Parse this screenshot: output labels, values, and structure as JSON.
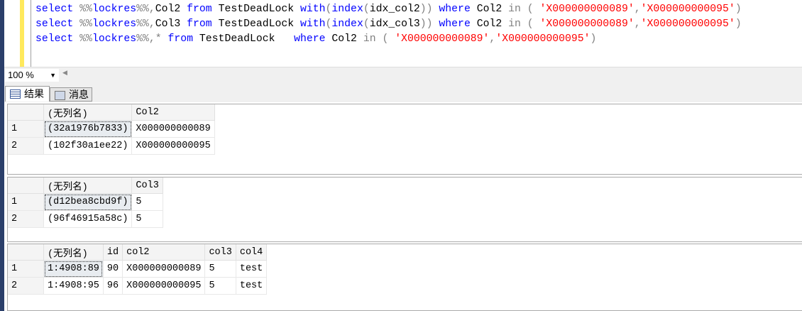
{
  "editor": {
    "lines": [
      [
        [
          "kw",
          "select "
        ],
        [
          "gr",
          "%%"
        ],
        [
          "kw",
          "lockres"
        ],
        [
          "gr",
          "%%,"
        ],
        [
          "tx",
          "Col2 "
        ],
        [
          "kw",
          "from "
        ],
        [
          "tx",
          "TestDeadLock "
        ],
        [
          "kw",
          "with"
        ],
        [
          "gr",
          "("
        ],
        [
          "kw",
          "index"
        ],
        [
          "gr",
          "("
        ],
        [
          "tx",
          "idx_col2"
        ],
        [
          "gr",
          "))"
        ],
        [
          "tx",
          " "
        ],
        [
          "kw",
          "where "
        ],
        [
          "tx",
          "Col2 "
        ],
        [
          "gr",
          "in ( "
        ],
        [
          "st",
          "'X000000000089'"
        ],
        [
          "gr",
          ","
        ],
        [
          "st",
          "'X000000000095'"
        ],
        [
          "gr",
          ")"
        ]
      ],
      [
        [
          "kw",
          "select "
        ],
        [
          "gr",
          "%%"
        ],
        [
          "kw",
          "lockres"
        ],
        [
          "gr",
          "%%,"
        ],
        [
          "tx",
          "Col3 "
        ],
        [
          "kw",
          "from "
        ],
        [
          "tx",
          "TestDeadLock "
        ],
        [
          "kw",
          "with"
        ],
        [
          "gr",
          "("
        ],
        [
          "kw",
          "index"
        ],
        [
          "gr",
          "("
        ],
        [
          "tx",
          "idx_col3"
        ],
        [
          "gr",
          "))"
        ],
        [
          "tx",
          " "
        ],
        [
          "kw",
          "where "
        ],
        [
          "tx",
          "Col2 "
        ],
        [
          "gr",
          "in ( "
        ],
        [
          "st",
          "'X000000000089'"
        ],
        [
          "gr",
          ","
        ],
        [
          "st",
          "'X000000000095'"
        ],
        [
          "gr",
          ")"
        ]
      ],
      [
        [
          "kw",
          "select "
        ],
        [
          "gr",
          "%%"
        ],
        [
          "kw",
          "lockres"
        ],
        [
          "gr",
          "%%,* "
        ],
        [
          "kw",
          "from "
        ],
        [
          "tx",
          "TestDeadLock   "
        ],
        [
          "kw",
          "where "
        ],
        [
          "tx",
          "Col2 "
        ],
        [
          "gr",
          "in ( "
        ],
        [
          "st",
          "'X000000000089'"
        ],
        [
          "gr",
          ","
        ],
        [
          "st",
          "'X000000000095'"
        ],
        [
          "gr",
          ")"
        ]
      ]
    ]
  },
  "zoom": {
    "value": "100 %"
  },
  "tabs": [
    {
      "label": "结果",
      "icon": "grid-icon"
    },
    {
      "label": "消息",
      "icon": "message-icon"
    }
  ],
  "grids": [
    {
      "columns": [
        "(无列名)",
        "Col2"
      ],
      "rows": [
        [
          "1",
          "(32a1976b7833)",
          "X000000000089"
        ],
        [
          "2",
          "(102f30a1ee22)",
          "X000000000095"
        ]
      ]
    },
    {
      "columns": [
        "(无列名)",
        "Col3"
      ],
      "rows": [
        [
          "1",
          "(d12bea8cbd9f)",
          "5"
        ],
        [
          "2",
          "(96f46915a58c)",
          "5"
        ]
      ]
    },
    {
      "columns": [
        "(无列名)",
        "id",
        "col2",
        "col3",
        "col4"
      ],
      "rows": [
        [
          "1",
          "1:4908:89",
          "90",
          "X000000000089",
          "5",
          "test"
        ],
        [
          "2",
          "1:4908:95",
          "96",
          "X000000000095",
          "5",
          "test"
        ]
      ]
    }
  ]
}
